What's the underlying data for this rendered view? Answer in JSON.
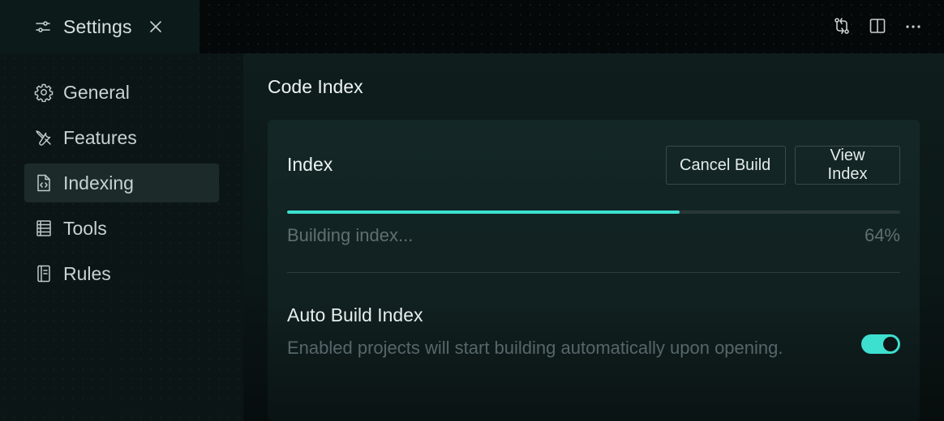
{
  "tab": {
    "label": "Settings",
    "icon": "sliders-icon",
    "close_icon": "close-icon"
  },
  "top_actions": [
    {
      "name": "compare-changes-icon"
    },
    {
      "name": "split-editor-icon"
    },
    {
      "name": "more-icon"
    }
  ],
  "sidebar": {
    "items": [
      {
        "label": "General",
        "icon": "gear-icon",
        "active": false
      },
      {
        "label": "Features",
        "icon": "tools-icon",
        "active": false
      },
      {
        "label": "Indexing",
        "icon": "code-file-icon",
        "active": true
      },
      {
        "label": "Tools",
        "icon": "tools-list-icon",
        "active": false
      },
      {
        "label": "Rules",
        "icon": "rules-book-icon",
        "active": false
      }
    ]
  },
  "main": {
    "section_title": "Code Index",
    "index_card": {
      "title": "Index",
      "cancel_label": "Cancel Build",
      "view_label": "View Index",
      "progress_text": "Building index...",
      "progress_percent": "64%",
      "progress_value": 0.64,
      "auto_build": {
        "title": "Auto Build Index",
        "description": "Enabled projects will start building automatically upon opening.",
        "enabled": true
      }
    }
  },
  "colors": {
    "accent": "#3de0cf",
    "active_nav_bg": "#1c2a2a",
    "muted_text": "#5f6f6f"
  }
}
